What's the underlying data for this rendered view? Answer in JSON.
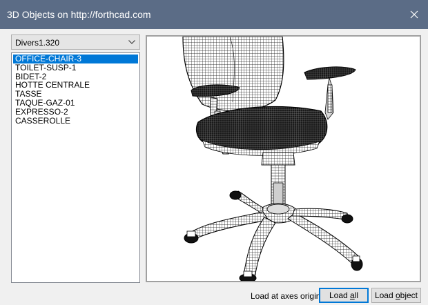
{
  "window": {
    "title": "3D Objects on http://forthcad.com"
  },
  "library_select": {
    "value": "Divers1.320"
  },
  "objects": [
    {
      "label": "OFFICE-CHAIR-3",
      "selected": true
    },
    {
      "label": "TOILET-SUSP-1",
      "selected": false
    },
    {
      "label": "BIDET-2",
      "selected": false
    },
    {
      "label": "HOTTE CENTRALE",
      "selected": false
    },
    {
      "label": "TASSE",
      "selected": false
    },
    {
      "label": "TAQUE-GAZ-01",
      "selected": false
    },
    {
      "label": "EXPRESSO-2",
      "selected": false
    },
    {
      "label": "CASSEROLLE",
      "selected": false
    }
  ],
  "footer": {
    "origin_label": "Load at axes origin",
    "load_all": {
      "pre": "Load ",
      "key": "a",
      "post": "ll"
    },
    "load_object": {
      "pre": "Load ",
      "key": "o",
      "post": "bject"
    }
  },
  "colors": {
    "titlebar": "#5b6c86",
    "selection": "#0078d7"
  }
}
